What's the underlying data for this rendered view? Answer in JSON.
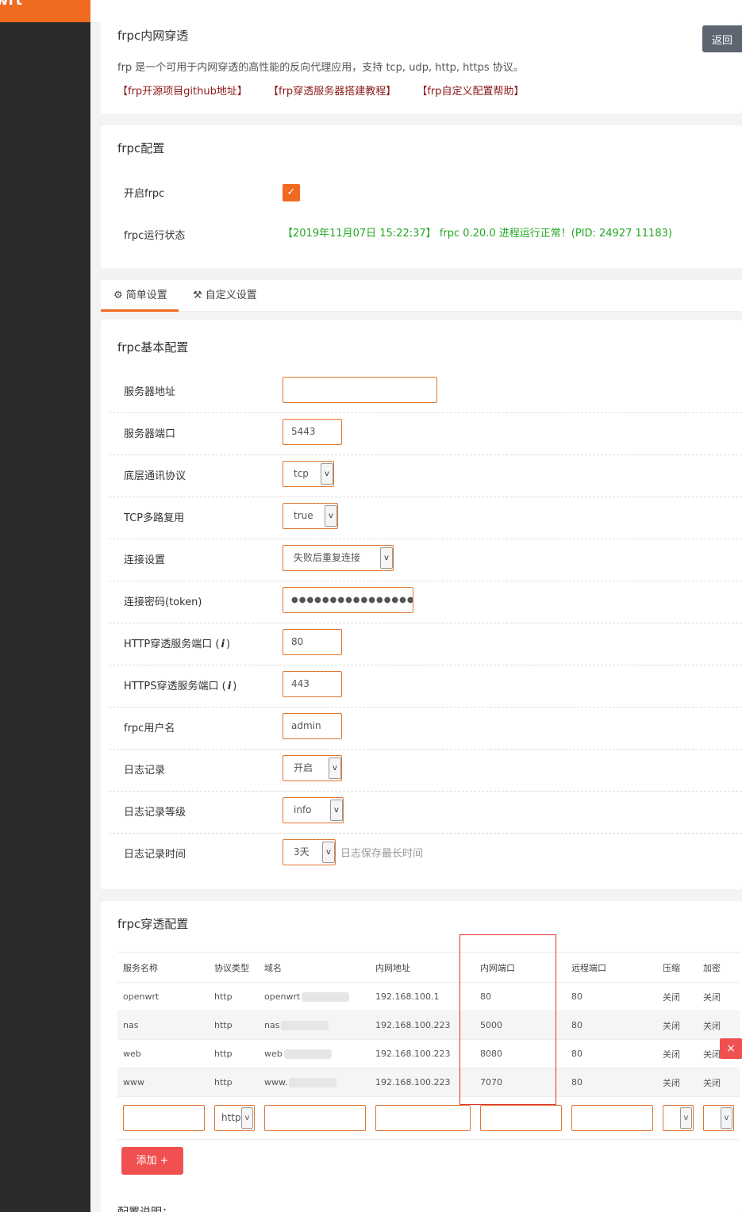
{
  "brand": {
    "logo_text": "wrt",
    "accent": "#f06a20"
  },
  "header": {
    "back_label": "返回"
  },
  "intro": {
    "title": "frpc内网穿透",
    "description": "frp 是一个可用于内网穿透的高性能的反向代理应用，支持 tcp, udp, http, https 协议。",
    "links": [
      "【frp开源项目github地址】",
      "【frp穿透服务器搭建教程】",
      "【frp自定义配置帮助】"
    ]
  },
  "frpc_config": {
    "title": "frpc配置",
    "enable_label": "开启frpc",
    "enable_mark": "✓",
    "status_label": "frpc运行状态",
    "status_text": "【2019年11月07日 15:22:37】 frpc 0.20.0 进程运行正常！(PID: 24927 11183)",
    "status_color": "#22a822"
  },
  "tabs": [
    {
      "icon": "gear-icon",
      "glyph": "⚙",
      "label": "简单设置"
    },
    {
      "icon": "tools-icon",
      "glyph": "⚒",
      "label": "自定义设置"
    }
  ],
  "basic": {
    "title": "frpc基本配置",
    "server_addr_label": "服务器地址",
    "server_port_label": "服务器端口",
    "server_port": "5443",
    "protocol_label": "底层通讯协议",
    "protocol": "tcp",
    "tcp_mux_label": "TCP多路复用",
    "tcp_mux": "true",
    "connect_label": "连接设置",
    "connect": "失败后重复连接",
    "token_label": "连接密码(token)",
    "token": "●●●●●●●●●●●●●●●●",
    "http_port_label_a": "HTTP穿透服务端口 (",
    "http_port_label_b": ")",
    "http_port": "80",
    "https_port_label_a": "HTTPS穿透服务端口 (",
    "https_port_label_b": ")",
    "https_port": "443",
    "user_label": "frpc用户名",
    "user": "admin",
    "log_label": "日志记录",
    "log": "开启",
    "log_level_label": "日志记录等级",
    "log_level": "info",
    "log_days_label": "日志记录时间",
    "log_days": "3天",
    "log_days_hint": "日志保存最长时间",
    "info_glyph": "i",
    "arrow_glyph": "v"
  },
  "proxy": {
    "title": "frpc穿透配置",
    "columns": [
      "服务名称",
      "协议类型",
      "域名",
      "内网地址",
      "内网端口",
      "远程端口",
      "压缩",
      "加密"
    ],
    "rows": [
      [
        "openwrt",
        "http",
        "openwrt",
        "192.168.100.1",
        "80",
        "80",
        "关闭",
        "关闭"
      ],
      [
        "nas",
        "http",
        "nas",
        "192.168.100.223",
        "5000",
        "80",
        "关闭",
        "关闭"
      ],
      [
        "web",
        "http",
        "web",
        "192.168.100.223",
        "8080",
        "80",
        "关闭",
        "关闭"
      ],
      [
        "www",
        "http",
        "www.",
        "192.168.100.223",
        "7070",
        "80",
        "关闭",
        "关闭"
      ]
    ],
    "new_type": "http",
    "delete_glyph": "×",
    "add_label": "添加 +"
  },
  "footer": {
    "note_title": "配置说明："
  }
}
